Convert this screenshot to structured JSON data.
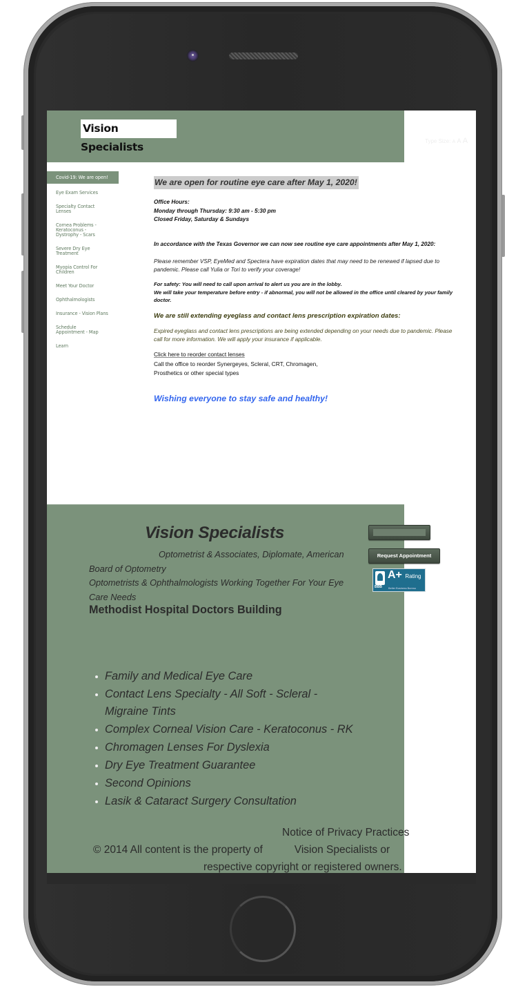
{
  "device": {
    "camera_icon": "front-camera-icon",
    "speaker_icon": "earpiece-speaker-icon",
    "home_button_icon": "home-button-icon"
  },
  "header": {
    "logo_text": "Vision Specialists",
    "type_size_label": "Type Size:",
    "type_size_options": [
      "A",
      "A",
      "A"
    ]
  },
  "sidebar": {
    "items": [
      {
        "label": "Covid-19: We are open!",
        "active": true
      },
      {
        "label": "Eye Exam Services"
      },
      {
        "label": "Specialty Contact Lenses"
      },
      {
        "label": "Cornea Problems - Keratoconus - Dystrophy - Scars"
      },
      {
        "label": "Severe Dry Eye Treatment"
      },
      {
        "label": "Myopia Control For Children"
      },
      {
        "label": "Meet Your Doctor"
      },
      {
        "label": "Ophthalmologists"
      },
      {
        "label": "Insurance - Vision Plans"
      },
      {
        "label": "Schedule Appointment - Map"
      },
      {
        "label": "Learn"
      }
    ]
  },
  "main": {
    "headline": "We are open for routine eye care after May 1, 2020!",
    "office_hours": {
      "title": "Office Hours:",
      "line1": "Monday through Thursday: 9:30 am - 5:30 pm",
      "line2": "Closed Friday, Saturday & Sundays"
    },
    "governor_note": "In accordance with the Texas Governor we can now see routine eye care appointments after May 1, 2020:",
    "insurance_note": "Please remember VSP, EyeMed and Spectera have expiration dates that may need to be renewed if lapsed due to pandemic. Please call Yulia or Tori to verify your coverage!",
    "safety_line1": "For safety: You will need to call upon arrival to alert us you are in the lobby.",
    "safety_line2": "We will take your temperature before entry - if abnormal, you will not be allowed in the office until cleared by your family doctor.",
    "extending_heading": "We are still extending eyeglass and contact lens prescription expiration dates:",
    "extending_text": "Expired eyeglass and contact lens prescriptions are being extended depending on your needs due to pandemic. Please call for more information. We will apply your insurance if applicable.",
    "reorder_link": "Click here to reorder contact lenses",
    "reorder_line1": "Call the office to reorder Synergeyes, Scleral, CRT, Chromagen,",
    "reorder_line2": "Prosthetics or other special types",
    "wish": "Wishing everyone to stay safe and healthy!"
  },
  "footer": {
    "title": "Vision Specialists",
    "credentials_line1": "Optometrist & Associates, Diplomate, American Board of Optometry",
    "credentials_line2": "Optometrists & Ophthalmologists Working Together For Your Eye Care Needs",
    "address": "Methodist Hospital Doctors Building",
    "services": [
      "Family and Medical Eye Care",
      "Contact Lens Specialty - All Soft - Scleral - Migraine Tints",
      "Complex Corneal Vision Care - Keratoconus - RK",
      "Chromagen Lenses For Dyslexia",
      "Dry Eye Treatment Guarantee",
      "Second Opinions",
      "Lasik & Cataract Surgery Consultation"
    ],
    "blank_button_label": "",
    "request_button_label": "Request Appointment",
    "bbb": {
      "code": "BBB",
      "rating": "A+",
      "rating_word": "Rating",
      "subtitle": "Better Business Bureau"
    },
    "privacy_link": "Notice of Privacy Practices",
    "copyright_part1": "© 2014 All content is the property of",
    "copyright_part2": "Vision Specialists or",
    "copyright_part3": "respective copyright or registered owners."
  },
  "colors": {
    "brand_green": "#7b927b",
    "nav_text": "#5f7a5f",
    "headline_bg": "#cccccc",
    "wish_blue": "#3366ee",
    "olive_text": "#3d3d10",
    "bbb_blue": "#1f6e8e"
  }
}
